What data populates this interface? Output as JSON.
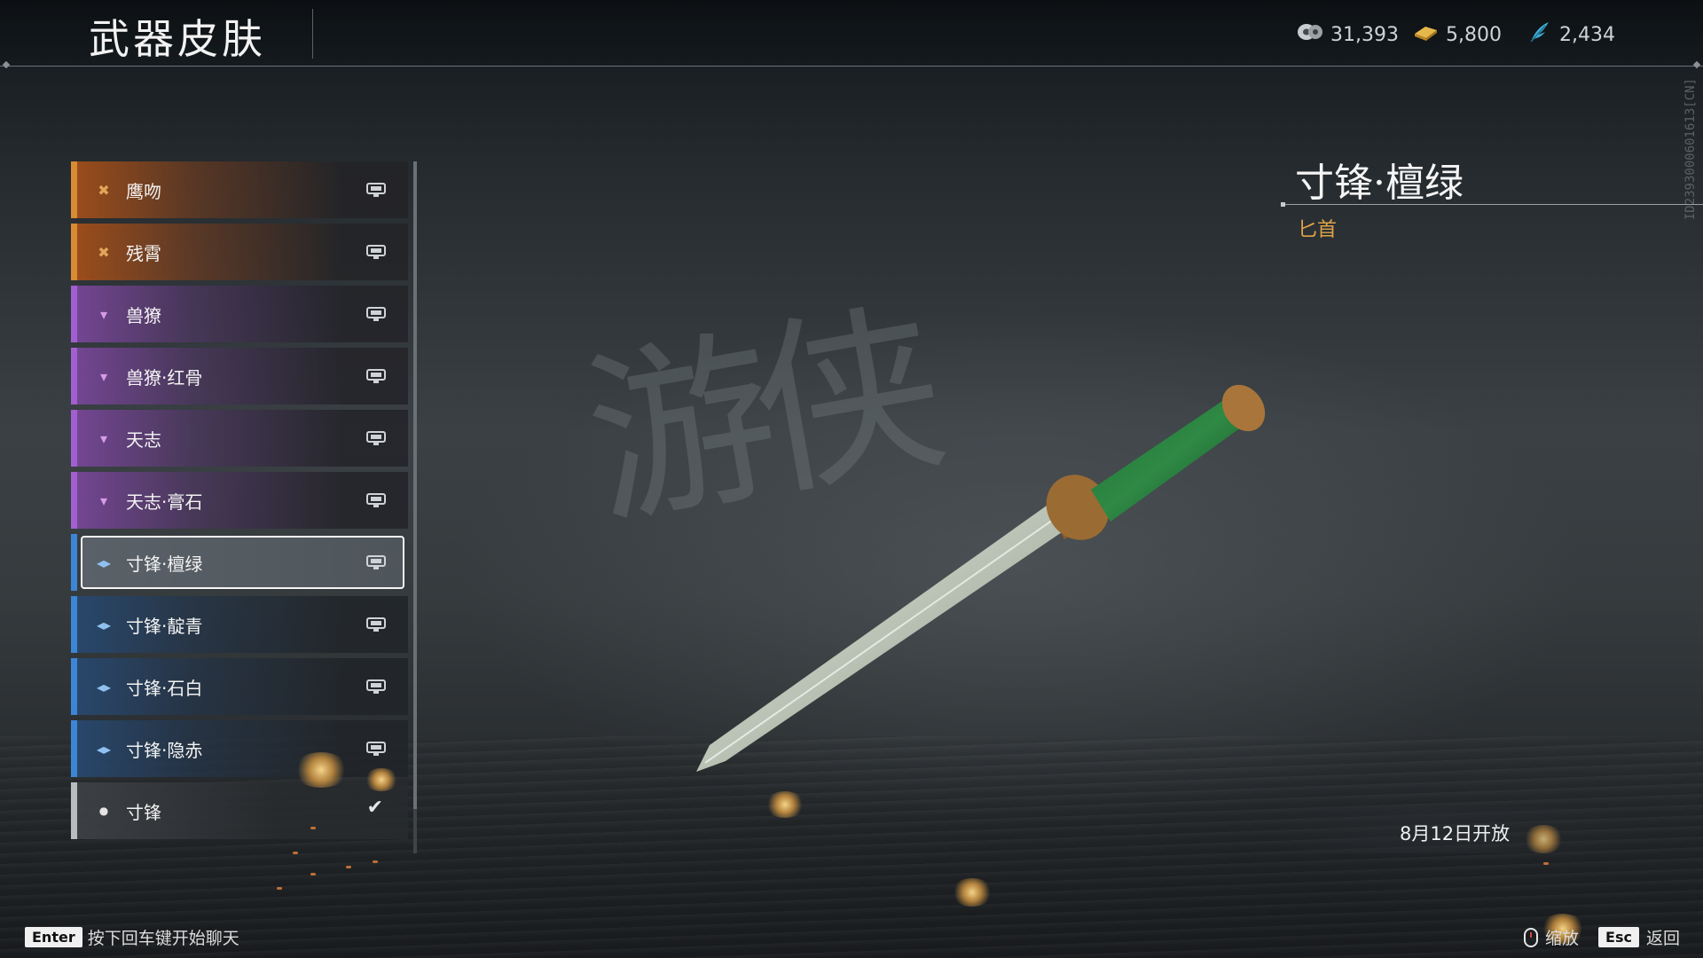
{
  "header": {
    "title": "武器皮肤",
    "currencies": [
      {
        "icon": "jade-coin-icon",
        "value": "31,393"
      },
      {
        "icon": "gold-ingot-icon",
        "value": "5,800"
      },
      {
        "icon": "blue-feather-icon",
        "value": "2,434"
      }
    ]
  },
  "side_id": "ID2393000601613[CN]",
  "skins": [
    {
      "label": "鹰吻",
      "rarity": "orange",
      "rarity_icon": "orange-rarity-icon",
      "state": "locked"
    },
    {
      "label": "残霄",
      "rarity": "orange",
      "rarity_icon": "orange-rarity-icon",
      "state": "locked"
    },
    {
      "label": "兽獠",
      "rarity": "purple",
      "rarity_icon": "purple-rarity-icon",
      "state": "locked"
    },
    {
      "label": "兽獠·红骨",
      "rarity": "purple",
      "rarity_icon": "purple-rarity-icon",
      "state": "locked"
    },
    {
      "label": "天志",
      "rarity": "purple",
      "rarity_icon": "purple-rarity-icon",
      "state": "locked"
    },
    {
      "label": "天志·膏石",
      "rarity": "purple",
      "rarity_icon": "purple-rarity-icon",
      "state": "locked"
    },
    {
      "label": "寸锋·檀绿",
      "rarity": "blue",
      "rarity_icon": "blue-rarity-icon",
      "state": "locked",
      "selected": true
    },
    {
      "label": "寸锋·靛青",
      "rarity": "blue",
      "rarity_icon": "blue-rarity-icon",
      "state": "locked"
    },
    {
      "label": "寸锋·石白",
      "rarity": "blue",
      "rarity_icon": "blue-rarity-icon",
      "state": "locked"
    },
    {
      "label": "寸锋·隐赤",
      "rarity": "blue",
      "rarity_icon": "blue-rarity-icon",
      "state": "locked"
    },
    {
      "label": "寸锋",
      "rarity": "white",
      "rarity_icon": "white-rarity-icon",
      "state": "equipped"
    }
  ],
  "detail": {
    "name": "寸锋·檀绿",
    "type": "匕首",
    "open_date": "8月12日开放"
  },
  "footer": {
    "chat_key": "Enter",
    "chat_hint": "按下回车键开始聊天",
    "zoom_label": "缩放",
    "back_key": "Esc",
    "back_label": "返回"
  },
  "colors": {
    "orange": "#d88b33",
    "purple": "#a25fd0",
    "blue": "#3d86d6",
    "white": "#b8bcbf",
    "type_text": "#e0a247"
  }
}
